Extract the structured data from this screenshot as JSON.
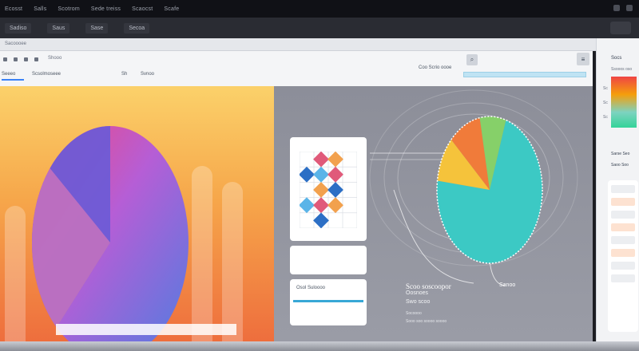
{
  "menubar": {
    "items": [
      "Ecosst",
      "Salls",
      "Scotrom",
      "Sede treiss",
      "Scaocst",
      "Scafe"
    ]
  },
  "toolbar": {
    "items": [
      "Sadiso",
      "Saus",
      "Sase",
      "Secoa"
    ]
  },
  "addressbar": {
    "text": "Sacoooee"
  },
  "page": {
    "breadcrumb": "Shooo",
    "tabs": [
      "Seeeo",
      "Scsolmoseee",
      "Sh",
      "Svnoo"
    ],
    "search_label": "Coo Scrio oooe",
    "search_button_icon": "search-icon",
    "search_placeholder": "",
    "side_button_icon": "filter-icon"
  },
  "left_chart": {
    "colors": [
      "#f2467e",
      "#a855f7",
      "#4f7de0",
      "#6b5bd6"
    ]
  },
  "cards": {
    "card3_title": "Osol Suloooo"
  },
  "caption": {
    "main": "Scoo soscoopor",
    "side": "Sanoo",
    "sub": "Oosnoes",
    "note": "Swo scoo",
    "tiny": "Socoooo",
    "foot": "Sooo soo soooo soooo"
  },
  "right_panel": {
    "title": "Socs",
    "subtitle": "Ssooos oso",
    "legend_ticks": [
      "Sc",
      "Sc",
      "Sc"
    ],
    "labels": [
      "Sarse Seo",
      "Saoo Soo"
    ]
  },
  "chart_data": [
    {
      "type": "pie",
      "title": "",
      "values": [
        62,
        24,
        14
      ],
      "colors": [
        "#6b5bd6",
        "#f2467e",
        "#a855f7"
      ]
    },
    {
      "type": "pie",
      "title": "",
      "values": [
        72,
        10,
        10,
        8
      ],
      "colors": [
        "#3cc9c4",
        "#f5c33b",
        "#f07b3a",
        "#86d069"
      ]
    },
    {
      "type": "heatmap",
      "title": "",
      "rows": 5,
      "cols": 4,
      "colors": [
        "#e05a7a",
        "#f2a14e",
        "#2c6fc5",
        "#5ab4e8"
      ]
    }
  ]
}
